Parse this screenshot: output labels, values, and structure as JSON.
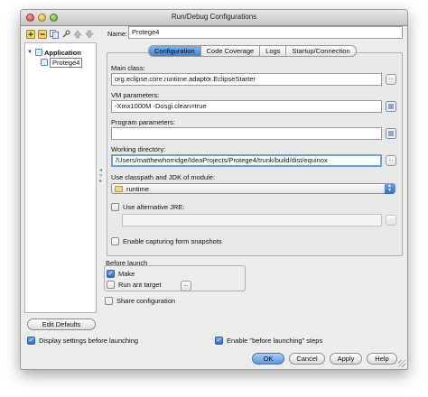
{
  "window": {
    "title": "Run/Debug Configurations"
  },
  "toolbar": {
    "icons": [
      "add-icon",
      "remove-icon",
      "copy-icon",
      "wrench-icon",
      "move-up-icon",
      "move-down-icon"
    ]
  },
  "tree": {
    "root_label": "Application",
    "child_label": "Protege4"
  },
  "name": {
    "label": "Name:",
    "value": "Protege4"
  },
  "tabs": [
    {
      "label": "Configuration",
      "active": true
    },
    {
      "label": "Code Coverage",
      "active": false
    },
    {
      "label": "Logs",
      "active": false
    },
    {
      "label": "Startup/Connection",
      "active": false
    }
  ],
  "config": {
    "main_class_label": "Main class:",
    "main_class_value": "org.eclipse.core.runtime.adaptor.EclipseStarter",
    "vm_params_label": "VM parameters:",
    "vm_params_value": "-Xmx1000M -Dosgi.clean=true",
    "program_params_label": "Program parameters:",
    "program_params_value": "",
    "working_dir_label": "Working directory:",
    "working_dir_value": "/Users/matthewhorridge/IdeaProjects/Protege4/trunk/build/dist/equinox",
    "classpath_label": "Use classpath and JDK of module:",
    "classpath_value": "runtime",
    "alt_jre_label": "Use alternative JRE:",
    "alt_jre_value": "",
    "alt_jre_checked": false,
    "form_snapshots_label": "Enable capturing form snapshots",
    "form_snapshots_checked": false,
    "browse_label": "..."
  },
  "before_launch": {
    "title": "Before launch",
    "make_label": "Make",
    "make_checked": true,
    "ant_label": "Run ant target",
    "ant_checked": false,
    "ant_button": "..."
  },
  "share_label": "Share configuration",
  "edit_defaults_label": "Edit Defaults",
  "footer": {
    "display_settings_label": "Display settings before launching",
    "enable_steps_label": "Enable \"before launching\" steps"
  },
  "buttons": {
    "ok": "OK",
    "cancel": "Cancel",
    "apply": "Apply",
    "help": "Help"
  },
  "colors": {
    "accent": "#3c86d8",
    "focus_ring": "#6b9ee0"
  }
}
